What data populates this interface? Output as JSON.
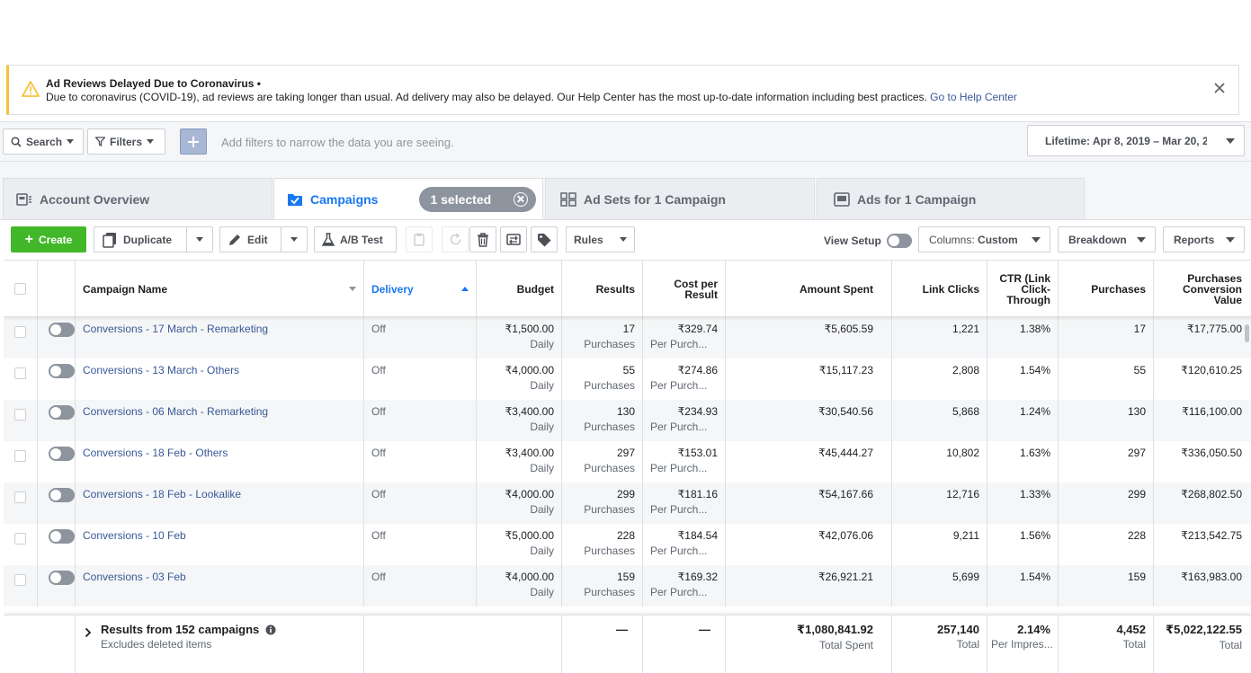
{
  "banner": {
    "title": "Ad Reviews Delayed Due to Coronavirus •",
    "text": "Due to coronavirus (COVID-19), ad reviews are taking longer than usual. Ad delivery may also be delayed. Our Help Center has the most up-to-date information including best practices.",
    "link": "Go to Help Center",
    "accent": "#f5c33b"
  },
  "filterbar": {
    "search_label": "Search",
    "filters_label": "Filters",
    "hint": "Add filters to narrow the data you are seeing.",
    "date_range": "Lifetime: Apr 8, 2019 – Mar 20, 2"
  },
  "tabs": {
    "account_overview": "Account Overview",
    "campaigns": "Campaigns",
    "selected": "1 selected",
    "ad_sets": "Ad Sets for 1 Campaign",
    "ads": "Ads for 1 Campaign"
  },
  "toolbar": {
    "create": "Create",
    "duplicate": "Duplicate",
    "edit": "Edit",
    "ab_test": "A/B Test",
    "rules": "Rules",
    "view_setup": "View Setup",
    "columns_prefix": "Columns:",
    "columns_value": "Custom",
    "breakdown": "Breakdown",
    "reports": "Reports"
  },
  "columns": {
    "campaign_name": "Campaign Name",
    "delivery": "Delivery",
    "budget": "Budget",
    "results": "Results",
    "cost_per_result": "Cost per Result",
    "amount_spent": "Amount Spent",
    "link_clicks": "Link Clicks",
    "ctr": "CTR (Link Click-Through",
    "purchases": "Purchases",
    "purchases_value": "Purchases Conversion Value"
  },
  "rows": [
    {
      "name": "Conversions - 17 March - Remarketing",
      "delivery": "Off",
      "budget": "₹1,500.00",
      "budget_type": "Daily",
      "results": "17",
      "results_type": "Purchases",
      "cpr": "₹329.74",
      "cpr_type": "Per Purch...",
      "spent": "₹5,605.59",
      "clicks": "1,221",
      "ctr": "1.38%",
      "purchases": "17",
      "value": "₹17,775.00"
    },
    {
      "name": "Conversions - 13 March - Others",
      "delivery": "Off",
      "budget": "₹4,000.00",
      "budget_type": "Daily",
      "results": "55",
      "results_type": "Purchases",
      "cpr": "₹274.86",
      "cpr_type": "Per Purch...",
      "spent": "₹15,117.23",
      "clicks": "2,808",
      "ctr": "1.54%",
      "purchases": "55",
      "value": "₹120,610.25"
    },
    {
      "name": "Conversions - 06 March - Remarketing",
      "delivery": "Off",
      "budget": "₹3,400.00",
      "budget_type": "Daily",
      "results": "130",
      "results_type": "Purchases",
      "cpr": "₹234.93",
      "cpr_type": "Per Purch...",
      "spent": "₹30,540.56",
      "clicks": "5,868",
      "ctr": "1.24%",
      "purchases": "130",
      "value": "₹116,100.00"
    },
    {
      "name": "Conversions - 18 Feb - Others",
      "delivery": "Off",
      "budget": "₹3,400.00",
      "budget_type": "Daily",
      "results": "297",
      "results_type": "Purchases",
      "cpr": "₹153.01",
      "cpr_type": "Per Purch...",
      "spent": "₹45,444.27",
      "clicks": "10,802",
      "ctr": "1.63%",
      "purchases": "297",
      "value": "₹336,050.50"
    },
    {
      "name": "Conversions - 18 Feb - Lookalike",
      "delivery": "Off",
      "budget": "₹4,000.00",
      "budget_type": "Daily",
      "results": "299",
      "results_type": "Purchases",
      "cpr": "₹181.16",
      "cpr_type": "Per Purch...",
      "spent": "₹54,167.66",
      "clicks": "12,716",
      "ctr": "1.33%",
      "purchases": "299",
      "value": "₹268,802.50"
    },
    {
      "name": "Conversions - 10 Feb",
      "delivery": "Off",
      "budget": "₹5,000.00",
      "budget_type": "Daily",
      "results": "228",
      "results_type": "Purchases",
      "cpr": "₹184.54",
      "cpr_type": "Per Purch...",
      "spent": "₹42,076.06",
      "clicks": "9,211",
      "ctr": "1.56%",
      "purchases": "228",
      "value": "₹213,542.75"
    },
    {
      "name": "Conversions - 03 Feb",
      "delivery": "Off",
      "budget": "₹4,000.00",
      "budget_type": "Daily",
      "results": "159",
      "results_type": "Purchases",
      "cpr": "₹169.32",
      "cpr_type": "Per Purch...",
      "spent": "₹26,921.21",
      "clicks": "5,699",
      "ctr": "1.54%",
      "purchases": "159",
      "value": "₹163,983.00"
    }
  ],
  "footer": {
    "title": "Results from 152 campaigns",
    "subtitle": "Excludes deleted items",
    "results": "—",
    "cpr": "—",
    "spent": "₹1,080,841.92",
    "spent_label": "Total Spent",
    "clicks": "257,140",
    "clicks_label": "Total",
    "ctr": "2.14%",
    "ctr_label": "Per Impres...",
    "purchases": "4,452",
    "purchases_label": "Total",
    "value": "₹5,022,122.55",
    "value_label": "Total"
  }
}
